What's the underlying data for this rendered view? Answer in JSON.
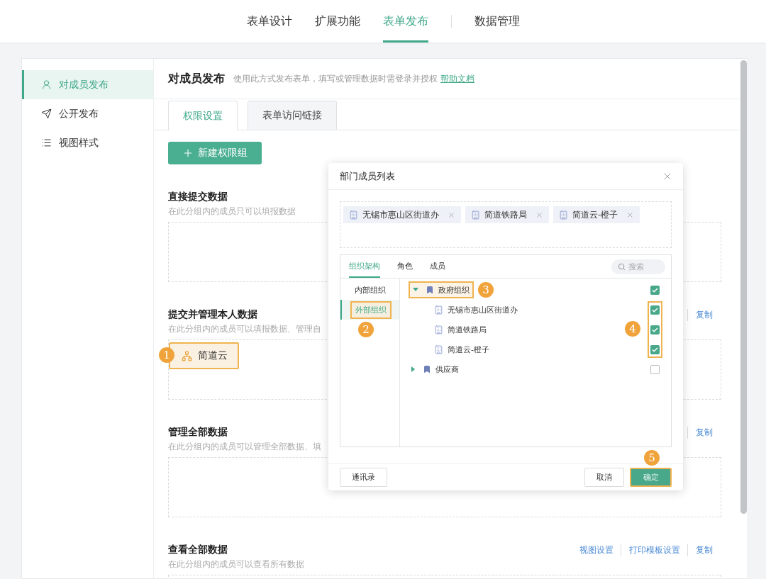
{
  "nav": [
    {
      "label": "表单设计",
      "selected": false,
      "separated_before": false
    },
    {
      "label": "扩展功能",
      "selected": false,
      "separated_before": false
    },
    {
      "label": "表单发布",
      "selected": true,
      "separated_before": false
    },
    {
      "label": "数据管理",
      "selected": false,
      "separated_before": true
    }
  ],
  "sidebar": [
    {
      "label": "对成员发布",
      "selected": true
    },
    {
      "label": "公开发布",
      "selected": false
    },
    {
      "label": "视图样式",
      "selected": false
    }
  ],
  "header": {
    "title": "对成员发布",
    "description": "使用此方式发布表单，填写或管理数据时需登录并授权",
    "link": "帮助文档"
  },
  "tabs": [
    {
      "label": "权限设置",
      "selected": true
    },
    {
      "label": "表单访问链接",
      "selected": false
    }
  ],
  "new_group_button": "新建权限组",
  "sections": [
    {
      "title": "直接提交数据",
      "description": "在此分组内的成员只可以填报数据"
    },
    {
      "title": "提交并管理本人数据",
      "description": "在此分组内的成员可以填报数据、管理自",
      "actions": [
        "复制"
      ],
      "members": [
        {
          "label": "简道云",
          "callout": "1"
        }
      ]
    },
    {
      "title": "管理全部数据",
      "description": "在此分组内的成员可以管理全部数据、填",
      "actions": [
        "复制"
      ]
    },
    {
      "title": "查看全部数据",
      "description": "在此分组内的成员可以查看所有数据",
      "actions": [
        "视图设置",
        "打印模板设置",
        "复制"
      ]
    }
  ],
  "dialog": {
    "title": "部门成员列表",
    "selected_tags": [
      "无锡市惠山区街道办",
      "简道铁路局",
      "简道云-橙子"
    ],
    "tabs": [
      {
        "label": "组织架构",
        "selected": true
      },
      {
        "label": "角色",
        "selected": false
      },
      {
        "label": "成员",
        "selected": false
      }
    ],
    "search": {
      "placeholder": "搜索"
    },
    "categories": [
      {
        "label": "内部组织",
        "selected": false
      },
      {
        "label": "外部组织",
        "selected": true,
        "callout": "2"
      }
    ],
    "tree": [
      {
        "label": "政府组织",
        "expanded": true,
        "checked": true,
        "callout": "3",
        "children_callout": "4",
        "children": [
          {
            "label": "无锡市惠山区街道办",
            "checked": true
          },
          {
            "label": "简道铁路局",
            "checked": true
          },
          {
            "label": "简道云-橙子",
            "checked": true
          }
        ]
      },
      {
        "label": "供应商",
        "expanded": false,
        "checked": false
      }
    ],
    "contacts_button": "通讯录",
    "cancel_button": "取消",
    "confirm_button": "确定",
    "confirm_callout": "5"
  }
}
